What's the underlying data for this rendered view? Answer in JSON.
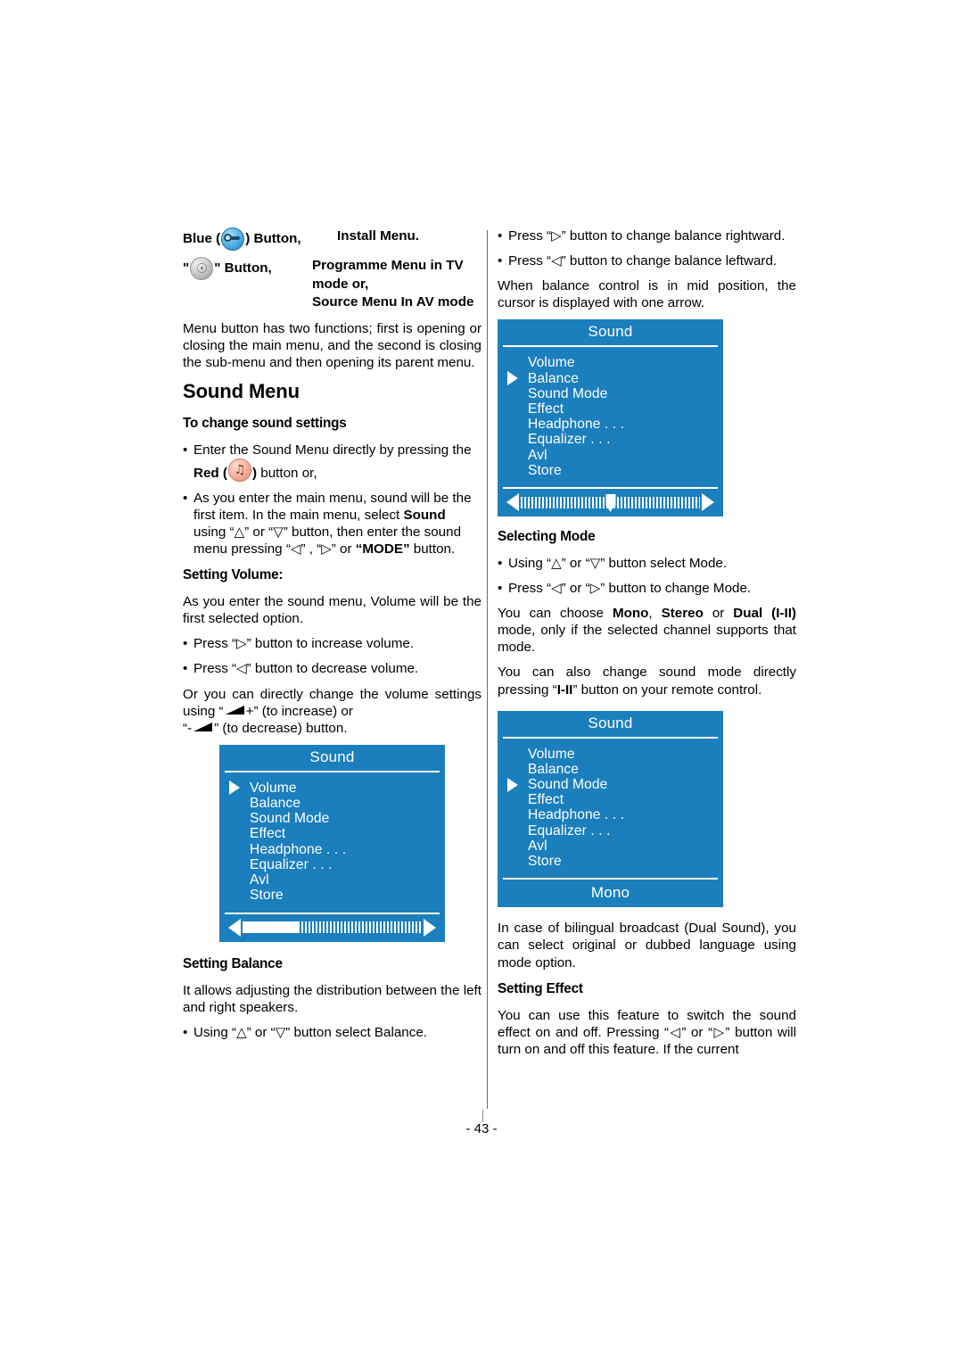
{
  "page": {
    "number_label": "- 43 -"
  },
  "left_column": {
    "key_table": {
      "rows": [
        {
          "key_prefix": "Blue (",
          "key_icon": "blue-round-button-icon",
          "key_suffix": ") Button,",
          "value_lines": [
            "Install Menu."
          ]
        },
        {
          "key_prefix": "\"",
          "key_icon": "antenna-round-button-icon",
          "key_suffix": "\" Button,",
          "value_lines": [
            "Programme Menu in TV",
            "mode or,",
            "Source Menu In AV mode"
          ]
        }
      ]
    },
    "intro_paragraph": "Menu button has two functions; first is opening or closing the main menu, and the second is closing the sub-menu and then opening its parent menu.",
    "section_heading": "Sound Menu",
    "sub_heading_1": "To change sound settings",
    "bullet_1_part1": "Enter the Sound Menu directly by pressing the ",
    "bullet_1_bold": "Red (",
    "bullet_1_icon": "red-music-note-button-icon",
    "bullet_1_bold_close": ")",
    "bullet_1_part2": " button or,",
    "bullet_2_a": "As you enter the main menu, sound will be the first item. In the main menu, select ",
    "bullet_2_b": "Sound",
    "bullet_2_c": " using “",
    "bullet_2_up": "△",
    "bullet_2_d": "” or “",
    "bullet_2_down": "▽",
    "bullet_2_e": "” button, then enter the sound menu pressing “",
    "bullet_2_left": "◁",
    "bullet_2_f": "” , “",
    "bullet_2_right": "▷",
    "bullet_2_g": "” or ",
    "bullet_2_mode": "“MODE”",
    "bullet_2_h": " button.",
    "sub_heading_2": "Setting Volume:",
    "volume_paragraph": "As you enter the sound menu, Volume will be the first selected option.",
    "volume_bullet_1_a": "Press “",
    "volume_bullet_1_arrow": "▷",
    "volume_bullet_1_b": "” button to increase volume.",
    "volume_bullet_2_a": "Press “",
    "volume_bullet_2_arrow": "◁",
    "volume_bullet_2_b": "” button to decrease volume.",
    "volume_direct_a": "Or you can directly change the volume settings using “",
    "volume_direct_plus": "+” (to increase) or",
    "volume_direct_minus_pre": "“-",
    "volume_direct_minus_post": "” (to decrease) button.",
    "sub_heading_3": "Setting Balance",
    "balance_paragraph": "It allows adjusting the distribution between the left and right speakers.",
    "balance_bullet_a": "Using “",
    "balance_bullet_up": "△",
    "balance_bullet_b": "” or “",
    "balance_bullet_down": "▽",
    "balance_bullet_c": "” button select Balance."
  },
  "right_column": {
    "bullet_1_a": "Press “",
    "bullet_1_arrow": "▷",
    "bullet_1_b": "” button to change balance rightward.",
    "bullet_2_a": "Press “",
    "bullet_2_arrow": "◁",
    "bullet_2_b": "” button to change balance leftward.",
    "mid_paragraph": "When balance control is in mid position, the cursor is displayed with one arrow.",
    "sub_heading_1": "Selecting Mode",
    "mode_bullet_1_a": "Using “",
    "mode_bullet_1_up": "△",
    "mode_bullet_1_b": "” or “",
    "mode_bullet_1_down": "▽",
    "mode_bullet_1_c": "” button select Mode.",
    "mode_bullet_2_a": "Press “",
    "mode_bullet_2_left": "◁",
    "mode_bullet_2_b": "” or “",
    "mode_bullet_2_right": "▷",
    "mode_bullet_2_c": "” button to change Mode.",
    "choose_a": "You can choose ",
    "choose_mono": "Mono",
    "choose_b": ", ",
    "choose_stereo": "Stereo",
    "choose_c": " or ",
    "choose_dual": "Dual",
    "choose_d": " ",
    "choose_dual2": "(I-II)",
    "choose_e": " mode, only if the selected channel supports that mode.",
    "direct_a": "You can also change sound mode directly pressing “",
    "direct_bold": "I-II",
    "direct_b": "” button on your remote control.",
    "bilingual_paragraph": "In case of bilingual broadcast (Dual Sound), you can select original or dubbed language using mode option.",
    "sub_heading_2": "Setting Effect",
    "effect_a": "You can use this feature to switch the sound effect on and off. Pressing “",
    "effect_left": "◁",
    "effect_b": "” or “",
    "effect_right": "▷",
    "effect_c": "” button will turn on and off this feature. If the current"
  },
  "osd_menus": {
    "colors": {
      "background": "#1b7fbd",
      "text": "#ffffff"
    },
    "volume": {
      "title": "Sound",
      "items": [
        "Volume",
        "Balance",
        "Sound Mode",
        "Effect",
        "Headphone . . .",
        "Equalizer . . .",
        "Avl",
        "Store"
      ],
      "selected_index": 0,
      "slider": {
        "type": "fill",
        "fill_percent": 31
      }
    },
    "balance": {
      "title": "Sound",
      "items": [
        "Volume",
        "Balance",
        "Sound Mode",
        "Effect",
        "Headphone . . .",
        "Equalizer . . .",
        "Avl",
        "Store"
      ],
      "selected_index": 1,
      "slider": {
        "type": "marker",
        "marker_percent": 50
      }
    },
    "mode": {
      "title": "Sound",
      "items": [
        "Volume",
        "Balance",
        "Sound Mode",
        "Effect",
        "Headphone . . .",
        "Equalizer . . .",
        "Avl",
        "Store"
      ],
      "selected_index": 2,
      "value_label": "Mono"
    }
  }
}
